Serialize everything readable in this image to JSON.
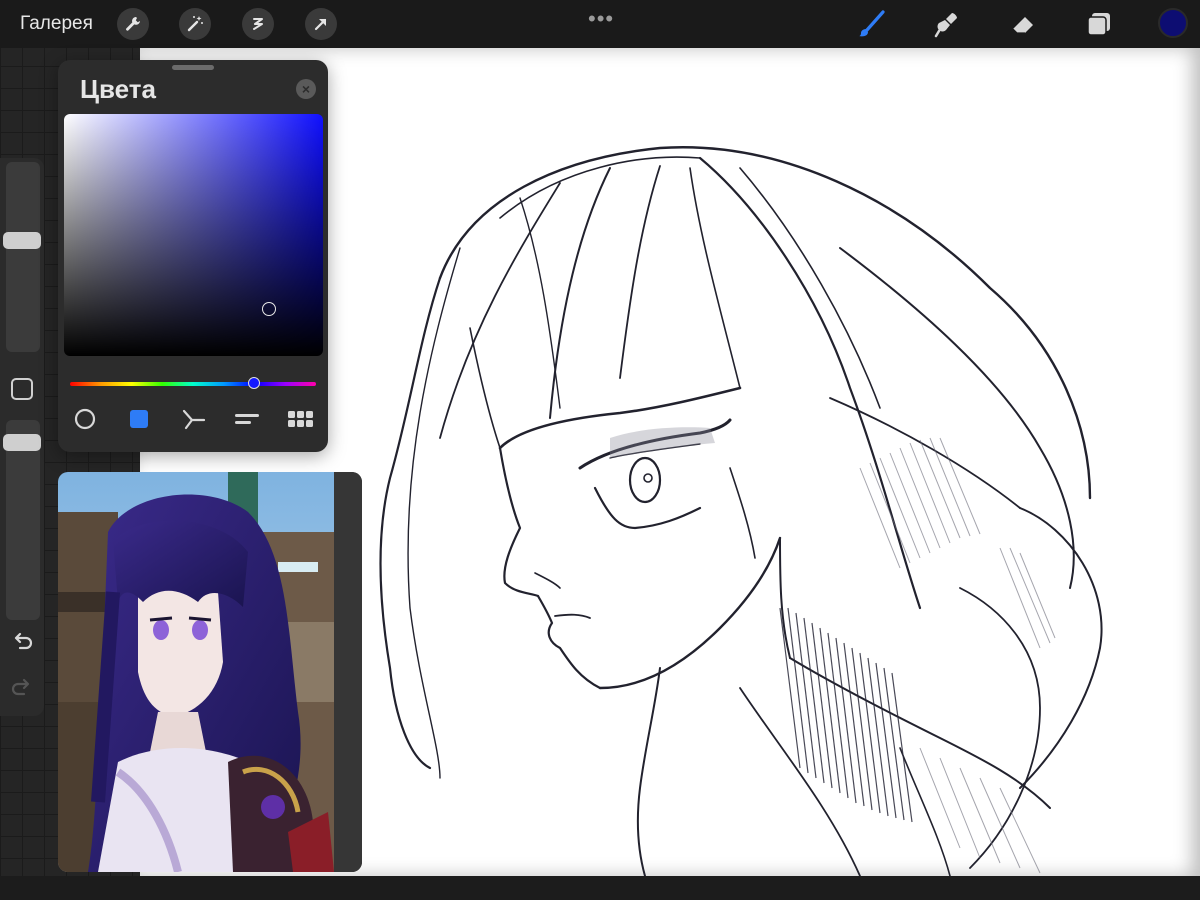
{
  "topbar": {
    "gallery_label": "Галерея",
    "left_tools": [
      {
        "name": "wrench-icon"
      },
      {
        "name": "magic-wand-icon"
      },
      {
        "name": "selection-icon"
      },
      {
        "name": "transform-arrow-icon"
      }
    ],
    "more_dots": "•••",
    "right_tools": [
      {
        "name": "brush-icon",
        "active": true
      },
      {
        "name": "smudge-icon"
      },
      {
        "name": "eraser-icon"
      },
      {
        "name": "layers-icon"
      }
    ],
    "current_color": "#0d0d72",
    "active_tool_color": "#2e7cf6"
  },
  "sidebar": {
    "brush_size_level": 0.58,
    "opacity_level": 0.85,
    "icons": [
      "modify-square-icon",
      "undo-icon",
      "redo-icon"
    ]
  },
  "color_panel": {
    "title": "Цвета",
    "close_icon": "close-icon",
    "hue_color": "#1010ff",
    "saturation": 0.8,
    "brightness": 0.2,
    "hue_position": 0.74,
    "tabs": [
      {
        "name": "disc-icon"
      },
      {
        "name": "classic-icon",
        "active": true
      },
      {
        "name": "harmony-icon"
      },
      {
        "name": "value-icon"
      },
      {
        "name": "palettes-icon"
      }
    ]
  },
  "reference": {
    "icon": "reference-image"
  },
  "canvas": {
    "stroke_color": "#22222e"
  }
}
